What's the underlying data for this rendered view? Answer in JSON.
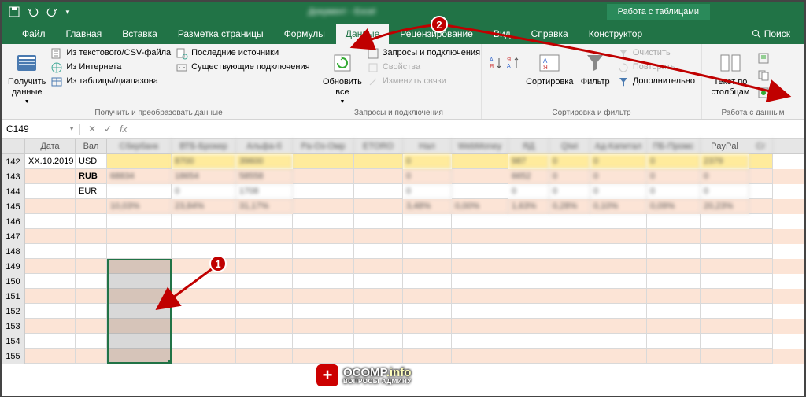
{
  "titlebar": {
    "doc_title": "Документ - Excel",
    "table_tools": "Работа с таблицами"
  },
  "tabs": {
    "file": "Файл",
    "home": "Главная",
    "insert": "Вставка",
    "layout": "Разметка страницы",
    "formulas": "Формулы",
    "data": "Данные",
    "review": "Рецензирование",
    "view": "Вид",
    "help": "Справка",
    "design": "Конструктор",
    "search": "Поиск"
  },
  "ribbon": {
    "get_data": "Получить данные",
    "from_csv": "Из текстового/CSV-файла",
    "from_web": "Из Интернета",
    "from_table": "Из таблицы/диапазона",
    "recent_sources": "Последние источники",
    "existing_conn": "Существующие подключения",
    "g1": "Получить и преобразовать данные",
    "refresh_all": "Обновить все",
    "queries": "Запросы и подключения",
    "properties": "Свойства",
    "edit_links": "Изменить связи",
    "g2": "Запросы и подключения",
    "sort": "Сортировка",
    "filter": "Фильтр",
    "clear": "Очистить",
    "reapply": "Повторить",
    "advanced": "Дополнительно",
    "g3": "Сортировка и фильтр",
    "text_to_cols": "Текст по столбцам",
    "g4": "Работа с данным"
  },
  "namebox": "C149",
  "columns": {
    "A": "Дата",
    "B": "Вал",
    "C": "Сбербанк",
    "D": "ВТБ-Брокер",
    "E": "Альфа-б",
    "F": "Ра-Оз-Омр",
    "G": "ETORO",
    "H": "Нал",
    "I": "WebMoney",
    "J": "ЯД",
    "K": "Qiwi",
    "L": "Ад-Капитал",
    "M": "ПБ-Промс",
    "N": "PayPal",
    "O": "Сг"
  },
  "rows": [
    {
      "num": "142",
      "banded": false,
      "A": "XX.10.2019",
      "B": "USD",
      "yellow": true,
      "C": "",
      "D": "8700",
      "E": "39600",
      "F": "",
      "G": "",
      "H": "0",
      "I": "",
      "J": "987",
      "K": "0",
      "L": "0",
      "M": "0",
      "N": "2379",
      "O": ""
    },
    {
      "num": "143",
      "banded": true,
      "A": "",
      "B": "RUB",
      "bold": true,
      "C": "68834",
      "D": "18654",
      "E": "58558",
      "F": "",
      "G": "",
      "H": "0",
      "I": "",
      "J": "6652",
      "K": "0",
      "L": "0",
      "M": "0",
      "N": "0",
      "O": ""
    },
    {
      "num": "144",
      "banded": false,
      "A": "",
      "B": "EUR",
      "C": "",
      "D": "0",
      "E": "1708",
      "F": "",
      "G": "",
      "H": "0",
      "I": "",
      "J": "0",
      "K": "0",
      "L": "0",
      "M": "0",
      "N": "0",
      "O": ""
    },
    {
      "num": "145",
      "banded": true,
      "A": "",
      "B": "",
      "C": "10,03%",
      "D": "23,84%",
      "E": "31,17%",
      "F": "",
      "G": "",
      "H": "3,48%",
      "I": "0,00%",
      "J": "1,63%",
      "K": "0,28%",
      "L": "0,10%",
      "M": "0,09%",
      "N": "20,23%",
      "O": ""
    },
    {
      "num": "146",
      "banded": false
    },
    {
      "num": "147",
      "banded": true
    },
    {
      "num": "148",
      "banded": false
    },
    {
      "num": "149",
      "banded": true
    },
    {
      "num": "150",
      "banded": false
    },
    {
      "num": "151",
      "banded": true
    },
    {
      "num": "152",
      "banded": false
    },
    {
      "num": "153",
      "banded": true
    },
    {
      "num": "154",
      "banded": false
    },
    {
      "num": "155",
      "banded": true
    }
  ],
  "annotations": {
    "badge1": "1",
    "badge2": "2"
  },
  "watermark": {
    "brand": "OCOMP",
    "domain": ".info",
    "sub": "ВОПРОСЫ АДМИНУ"
  }
}
